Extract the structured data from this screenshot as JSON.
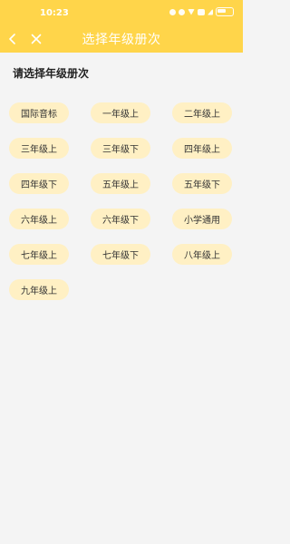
{
  "status_bar": {
    "time": "10:23",
    "icons": [
      "alarm-icon",
      "settings-icon",
      "wifi-icon",
      "sim-icon",
      "signal-icon",
      "battery-icon"
    ]
  },
  "header": {
    "title": "选择年级册次",
    "back_icon": "chevron-left-icon",
    "close_icon": "close-icon",
    "background_color": "#ffd54a"
  },
  "main": {
    "prompt": "请选择年级册次",
    "grades": [
      {
        "label": "国际音标"
      },
      {
        "label": "一年级上"
      },
      {
        "label": "二年级上"
      },
      {
        "label": "三年级上"
      },
      {
        "label": "三年级下"
      },
      {
        "label": "四年级上"
      },
      {
        "label": "四年级下"
      },
      {
        "label": "五年级上"
      },
      {
        "label": "五年级下"
      },
      {
        "label": "六年级上"
      },
      {
        "label": "六年级下"
      },
      {
        "label": "小学通用"
      },
      {
        "label": "七年级上"
      },
      {
        "label": "七年级下"
      },
      {
        "label": "八年级上"
      },
      {
        "label": "九年级上"
      }
    ],
    "button_color": "#fff0c4"
  }
}
